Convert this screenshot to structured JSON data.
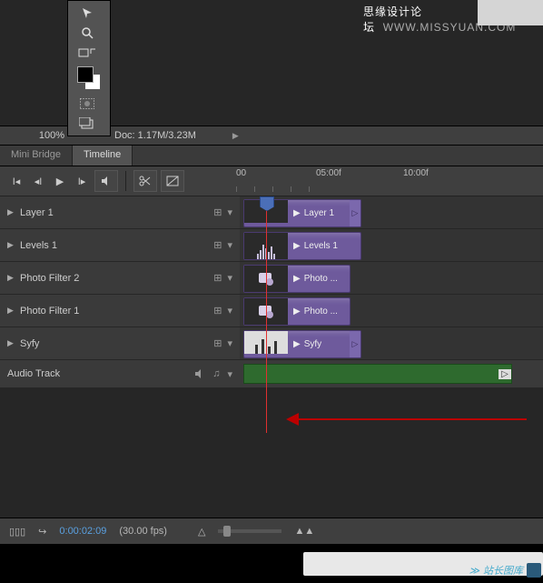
{
  "watermark_text": "思缘设计论坛",
  "watermark_url": "WWW.MISSYUAN.COM",
  "status": {
    "zoom": "100%",
    "doc": "Doc: 1.17M/3.23M"
  },
  "tabs": {
    "mini_bridge": "Mini Bridge",
    "timeline": "Timeline"
  },
  "ruler": {
    "t0": "00",
    "t1": "05:00f",
    "t2": "10:00f"
  },
  "tracks": [
    {
      "name": "Layer 1",
      "clip": "Layer 1",
      "thumb": "gradient"
    },
    {
      "name": "Levels 1",
      "clip": "Levels 1",
      "thumb": "levels"
    },
    {
      "name": "Photo Filter 2",
      "clip": "Photo ...",
      "thumb": "pf"
    },
    {
      "name": "Photo Filter 1",
      "clip": "Photo ...",
      "thumb": "pf"
    },
    {
      "name": "Syfy",
      "clip": "Syfy",
      "thumb": "syfy"
    }
  ],
  "audio": {
    "label": "Audio Track"
  },
  "footer": {
    "time": "0:00:02:09",
    "fps": "(30.00 fps)",
    "menu": "▯▯▯"
  },
  "badge": "站长图库"
}
